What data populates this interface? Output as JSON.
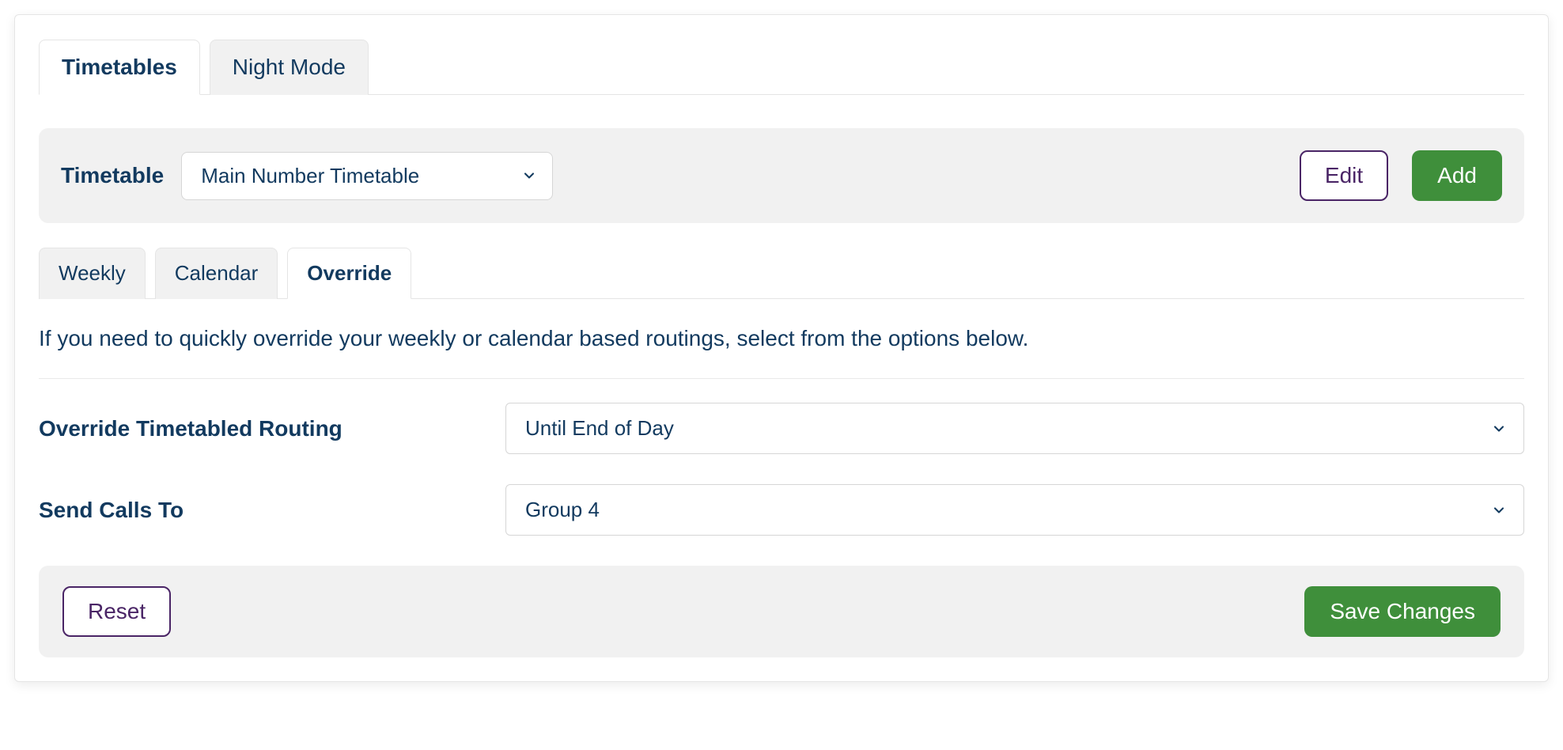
{
  "topTabs": {
    "timetables": "Timetables",
    "nightMode": "Night Mode"
  },
  "selectorBar": {
    "label": "Timetable",
    "selectValue": "Main Number Timetable",
    "editLabel": "Edit",
    "addLabel": "Add"
  },
  "subTabs": {
    "weekly": "Weekly",
    "calendar": "Calendar",
    "override": "Override"
  },
  "description": "If you need to quickly override your weekly or calendar based routings, select from the options below.",
  "form": {
    "overrideLabel": "Override Timetabled Routing",
    "overrideValue": "Until End of Day",
    "sendLabel": "Send Calls To",
    "sendValue": "Group 4"
  },
  "footer": {
    "resetLabel": "Reset",
    "saveLabel": "Save Changes"
  },
  "colors": {
    "textPrimary": "#123a5f",
    "accentPurple": "#4a2566",
    "green": "#3f8f3b",
    "panelGray": "#f1f1f1",
    "border": "#e5e5e5"
  }
}
